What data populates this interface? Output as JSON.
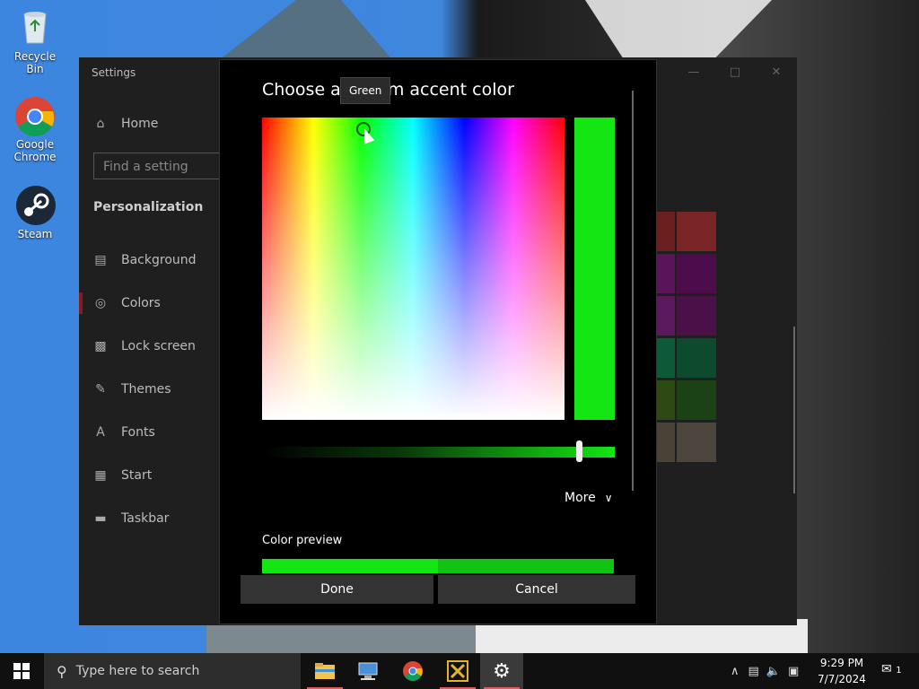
{
  "desktop": {
    "icons": [
      {
        "label": "Recycle Bin"
      },
      {
        "label": "Google Chrome"
      },
      {
        "label": "Steam"
      }
    ]
  },
  "settings": {
    "title": "Settings",
    "search_placeholder": "Find a setting",
    "home": "Home",
    "section": "Personalization",
    "nav": [
      {
        "label": "Background",
        "icon": "image-icon"
      },
      {
        "label": "Colors",
        "icon": "palette-icon"
      },
      {
        "label": "Lock screen",
        "icon": "lock-screen-icon"
      },
      {
        "label": "Themes",
        "icon": "themes-icon"
      },
      {
        "label": "Fonts",
        "icon": "fonts-icon"
      },
      {
        "label": "Start",
        "icon": "start-icon"
      },
      {
        "label": "Taskbar",
        "icon": "taskbar-icon"
      }
    ],
    "swatch_colors": [
      "#6b1f1f",
      "#7a2626",
      "#5a1558",
      "#4d0d4d",
      "#5a1a5c",
      "#4a1048",
      "#0f5a36",
      "#0e4a2e",
      "#2e4a12",
      "#1a4216",
      "#4a4236",
      "#4c463e"
    ]
  },
  "dialog": {
    "title_before": "Choose a",
    "title_after": "m accent color",
    "tooltip": "Green",
    "selected_color": "#14e614",
    "more_label": "More",
    "preview_label": "Color preview",
    "done_label": "Done",
    "cancel_label": "Cancel"
  },
  "taskbar": {
    "search_placeholder": "Type here to search",
    "time": "9:29 PM",
    "date": "7/7/2024",
    "notification_count": "1"
  }
}
